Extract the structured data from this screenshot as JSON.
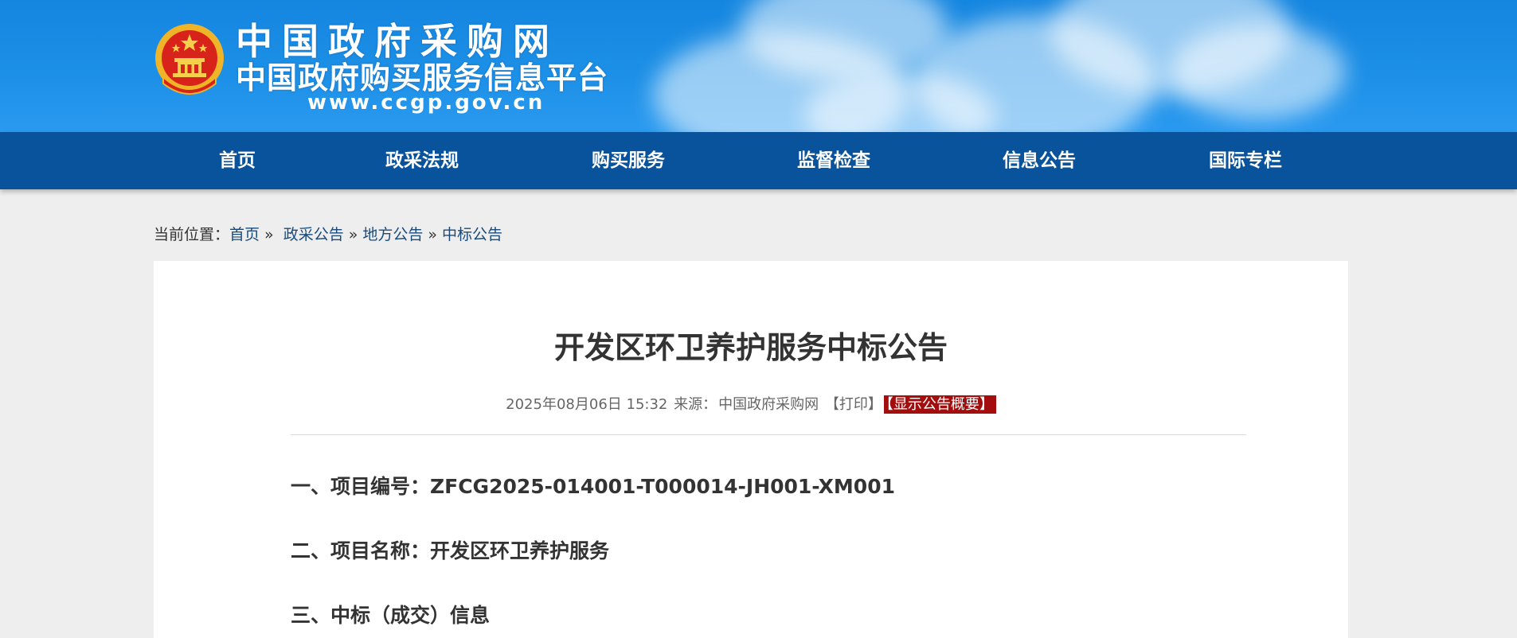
{
  "header": {
    "title": "中国政府采购网",
    "subtitle": "中国政府购买服务信息平台",
    "url": "www.ccgp.gov.cn",
    "emblem_icon": "national-emblem-icon",
    "colors": {
      "banner": "#1c8fe6",
      "nav": "#08539b"
    }
  },
  "nav": {
    "items": [
      {
        "label": "首页"
      },
      {
        "label": "政采法规"
      },
      {
        "label": "购买服务"
      },
      {
        "label": "监督检查"
      },
      {
        "label": "信息公告"
      },
      {
        "label": "国际专栏"
      }
    ]
  },
  "breadcrumb": {
    "prefix": "当前位置：",
    "items": [
      "首页",
      "政采公告",
      "地方公告",
      "中标公告"
    ],
    "separator": "»"
  },
  "article": {
    "title": "开发区环卫养护服务中标公告",
    "date": "2025年08月06日 15:32",
    "source_label": "来源：",
    "source": "中国政府采购网",
    "print_label": "【打印】",
    "summary_label": "【显示公告概要】",
    "summary_color": "#a30d0d",
    "sections": [
      {
        "text": "一、项目编号：ZFCG2025-014001-T000014-JH001-XM001"
      },
      {
        "text": "二、项目名称：开发区环卫养护服务"
      },
      {
        "text": "三、中标（成交）信息"
      }
    ]
  }
}
